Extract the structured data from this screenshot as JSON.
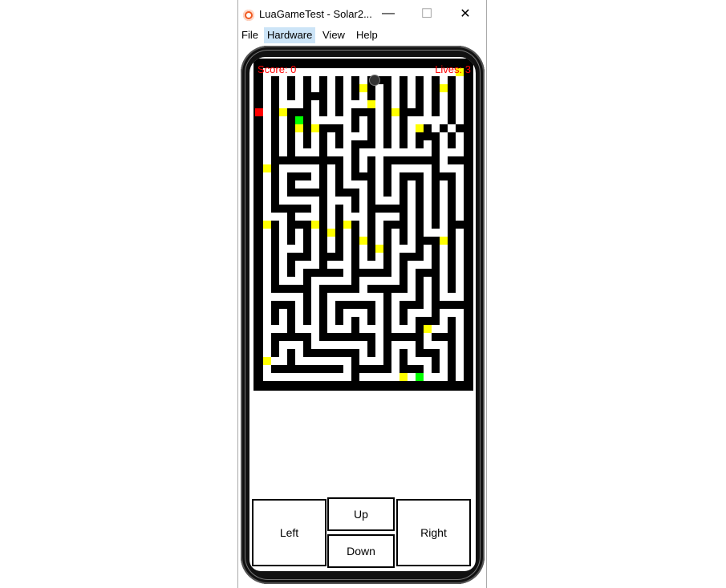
{
  "window": {
    "title": "LuaGameTest - Solar2...",
    "minimize": "—",
    "maximize": "☐",
    "close": "✕"
  },
  "menu": [
    "File",
    "Hardware",
    "View",
    "Help"
  ],
  "hud": {
    "score": "Score: 0",
    "lives": "Lives: 3"
  },
  "controls": {
    "left": "Left",
    "up": "Up",
    "down": "Down",
    "right": "Right"
  },
  "colors": {
    "wall": "#000000",
    "path": "#ffffff",
    "coin": "#ffff00",
    "player": "#ff0000",
    "goal": "#00ff00",
    "hud": "#ff0000"
  },
  "maze": {
    "rows": [
      "###########################",
      "#........................Y#",
      "#.#.#.#.#.#.#.###.#.#.#.#.#",
      "#.#.#.#.#.#.#Y#.#.#.#.#Y#.#",
      "#.#.#.###.#.#.#.#.#.#.#.#.#",
      "#.#...#.#.#...Y.#.#.#.#.#.#",
      "P.#Y###.#.#.###.#Y###.#.#.#",
      "#.#.#G#.....#.#.#.#.....#.#",
      "#.#.#Y#Y###.#.#.#.#.Y#.#.##",
      "#.#.#.#.#.#...#.#.#.###.#.#",
      "#.#.#.#.#.#.###.#.#.#.#.#.#",
      "#.#.#...#...#.........#...#",
      "#.#########.#.#.#######.###",
      "#Y#.....#.#.#.#.#.....#...#",
      "#.#.###.#.#.###.#.###.###.#",
      "#.#.#...#.#...#.#.#.#.#.#.#",
      "#.#.#####.###.#.#.#.#.#.#.#",
      "#.#.....#...#.#...#.#.#.#.#",
      "#.#####.#.#.#.#####.#.#.#.#",
      "#...#...#.#...#...#.#.#.#.#",
      "#Y#.###Y#.#Y#.#.###.#.#.###",
      "#.#.#.#.#Y#.#.#.#.#.#...#.#",
      "#.#.#.#.#.#.#Y#.#.#.###Y#.#",
      "#.#...#.#.#.#.#Y#...#.#.#.#",
      "#.#.###.###.#.#.#.###.#.#.#",
      "#.#.#...#...#...#.#...#.#.#",
      "#.#.#.#####.#####.#.###.#.#",
      "#.#...#.....#.....#.#.#.#.#",
      "#.#####.#####.#####.#.#.#.#",
      "#.....#.#.......#...#.#...#",
      "#.###.#.#.#####.#.###.#####",
      "#.#.#.#.#.#...#.#.#...#...#",
      "#.#.#.#.#.#.#.#.#.#.###.#.#",
      "#...#...#...#...#...#Y..#.#",
      "#.#####.#######.#####.###.#",
      "#.#...#.......#.#...#...#.#",
      "#.#.#.#######.#.#.#.###.#.#",
      "#Y..#.......#...#.#...#.#.#",
      "#.#########.#####.###.#.#.#",
      "#...........#.....Y.G...#.#",
      "###########################"
    ]
  }
}
